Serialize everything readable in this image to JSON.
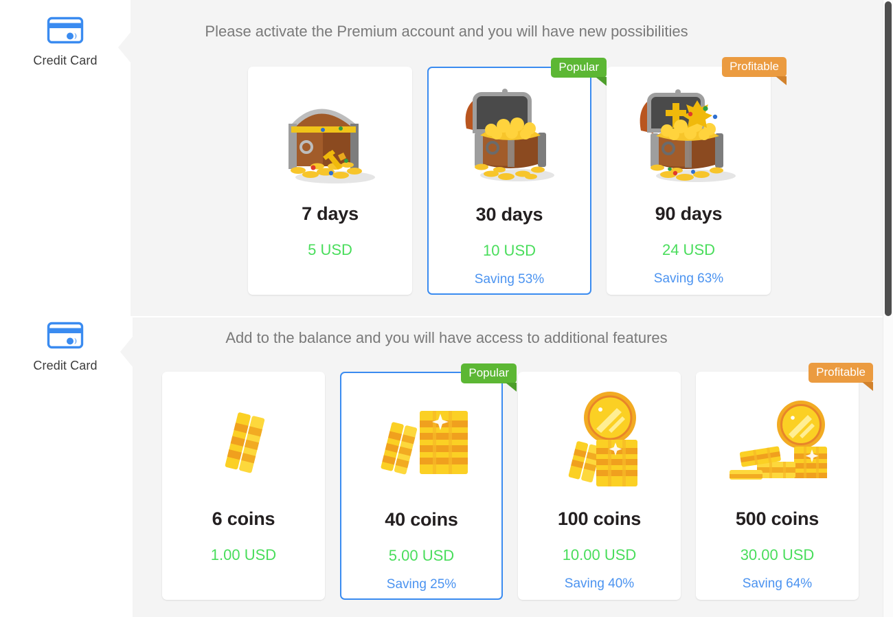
{
  "sections": [
    {
      "sidebar_label": "Credit Card",
      "sidebar_icon": "credit-card-icon",
      "heading": "Please activate the Premium account and you will have new possibilities",
      "cards": [
        {
          "art": "treasure-chest-closed-icon",
          "title": "7 days",
          "price": "5 USD",
          "saving": "",
          "badge": "",
          "selected": false
        },
        {
          "art": "treasure-chest-open-icon",
          "title": "30 days",
          "price": "10 USD",
          "saving": "Saving 53%",
          "badge": "Popular",
          "badge_color": "green",
          "selected": true
        },
        {
          "art": "treasure-chest-full-icon",
          "title": "90 days",
          "price": "24 USD",
          "saving": "Saving 63%",
          "badge": "Profitable",
          "badge_color": "orange",
          "selected": false
        }
      ]
    },
    {
      "sidebar_label": "Credit Card",
      "sidebar_icon": "credit-card-icon",
      "heading": "Add to the balance and you will have access to additional features",
      "cards": [
        {
          "art": "two-coin-bars-icon",
          "title": "6 coins",
          "price": "1.00 USD",
          "saving": "",
          "badge": "",
          "selected": false
        },
        {
          "art": "coin-stack-large-icon",
          "title": "40 coins",
          "price": "5.00 USD",
          "saving": "Saving 25%",
          "badge": "Popular",
          "badge_color": "green",
          "selected": true
        },
        {
          "art": "coin-with-stack-icon",
          "title": "100 coins",
          "price": "10.00 USD",
          "saving": "Saving 40%",
          "badge": "",
          "selected": false
        },
        {
          "art": "coin-pile-icon",
          "title": "500 coins",
          "price": "30.00 USD",
          "saving": "Saving 64%",
          "badge": "Profitable",
          "badge_color": "orange",
          "selected": false
        }
      ]
    }
  ],
  "colors": {
    "accent_blue": "#3a8bf0",
    "price_green": "#49dd5b",
    "saving_blue": "#4b93f0",
    "badge_green": "#5cb734",
    "badge_orange": "#eb9b40",
    "panel_gray": "#f4f4f4",
    "heading_gray": "#797979"
  }
}
